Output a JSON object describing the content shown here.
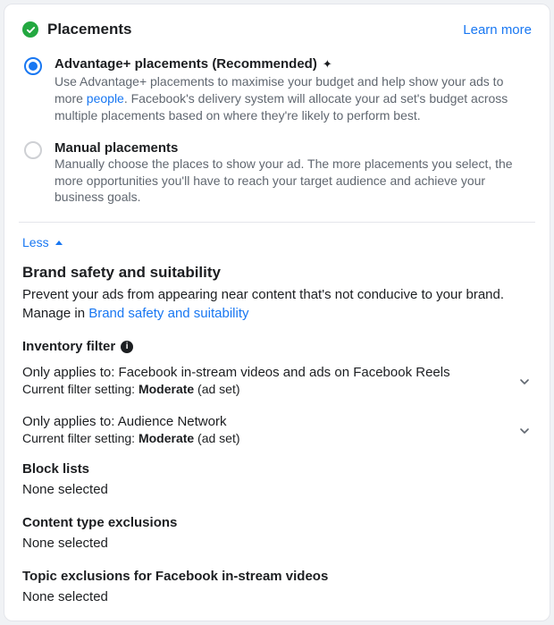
{
  "header": {
    "title": "Placements",
    "learn_more": "Learn more"
  },
  "options": {
    "advantage": {
      "title": "Advantage+ placements (Recommended)",
      "desc_pre": "Use Advantage+ placements to maximise your budget and help show your ads to more ",
      "desc_link": "people",
      "desc_post": ". Facebook's delivery system will allocate your ad set's budget across multiple placements based on where they're likely to perform best."
    },
    "manual": {
      "title": "Manual placements",
      "desc": "Manually choose the places to show your ad. The more placements you select, the more opportunities you'll have to reach your target audience and achieve your business goals."
    }
  },
  "toggle": {
    "less": "Less"
  },
  "brand": {
    "title": "Brand safety and suitability",
    "desc": "Prevent your ads from appearing near content that's not conducive to your brand.",
    "manage_pre": "Manage in ",
    "manage_link": "Brand safety and suitability"
  },
  "inventory": {
    "title": "Inventory filter",
    "filter1": {
      "applies": "Only applies to: Facebook in-stream videos and ads on Facebook Reels",
      "current_pre": "Current filter setting: ",
      "current_bold": "Moderate",
      "current_post": " (ad set)"
    },
    "filter2": {
      "applies": "Only applies to: Audience Network",
      "current_pre": "Current filter setting: ",
      "current_bold": "Moderate",
      "current_post": " (ad set)"
    }
  },
  "block_lists": {
    "title": "Block lists",
    "value": "None selected"
  },
  "content_excl": {
    "title": "Content type exclusions",
    "value": "None selected"
  },
  "topic_excl": {
    "title": "Topic exclusions for Facebook in-stream videos",
    "value": "None selected"
  }
}
